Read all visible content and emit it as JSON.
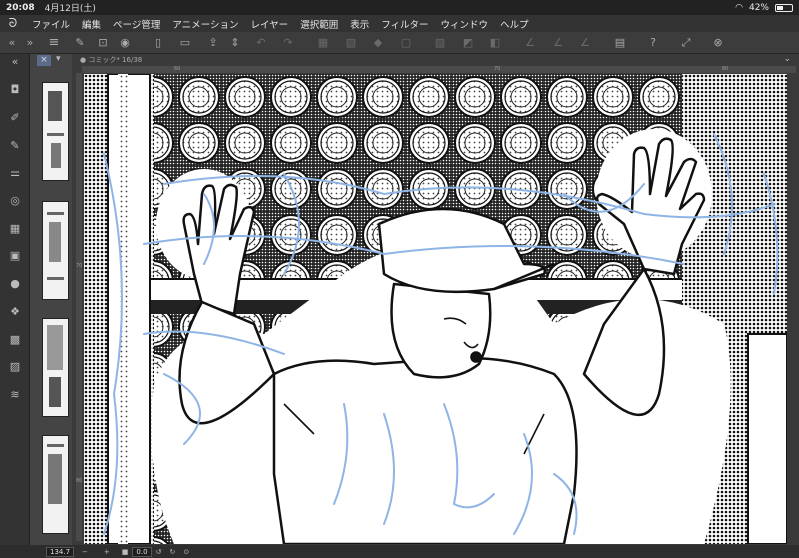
{
  "status_bar": {
    "time": "20:08",
    "date": "4月12日(土)",
    "battery_percent": "42%",
    "battery_level": 0.42
  },
  "menubar": {
    "items": [
      "ファイル",
      "編集",
      "ページ管理",
      "アニメーション",
      "レイヤー",
      "選択範囲",
      "表示",
      "フィルター",
      "ウィンドウ",
      "ヘルプ"
    ]
  },
  "toolbar": {
    "icons": [
      "menu-icon",
      "cut-icon",
      "copy-icon",
      "new-page-icon",
      "open-folder-icon",
      "save-icon",
      "updown-icon",
      "undo-icon",
      "redo-icon",
      "clear-icon",
      "crop-icon",
      "fill-icon",
      "transform-icon",
      "select-all-icon",
      "deselect-icon",
      "invert-icon",
      "ruler-icon",
      "ruler2-icon",
      "ruler3-icon",
      "layer-icon",
      "help-icon",
      "fit-icon",
      "ruler-snap-icon"
    ]
  },
  "document_tab": {
    "label": "● コミック* 16/38"
  },
  "ruler": {
    "h_ticks": [
      "60",
      "70",
      "80"
    ],
    "v_ticks": [
      "70",
      "80"
    ]
  },
  "bottom_bar": {
    "zoom": "134.7",
    "rotation": "0.0",
    "zoom_minus": "−",
    "zoom_plus": "+"
  },
  "colors": {
    "bg": "#2b2b2b",
    "toolbar": "#3c3c3c",
    "accent": "#5b6b8c",
    "pencil_blue": "#8fb4e6"
  }
}
